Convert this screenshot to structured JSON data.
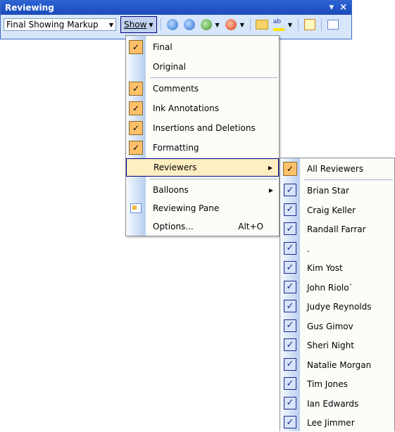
{
  "toolbar": {
    "title": "Reviewing",
    "title_controls": {
      "dropdown": "▾",
      "close": "×"
    },
    "display_for_review": "Final Showing Markup",
    "show_label": "Show",
    "highlight_glyph": "ab"
  },
  "show_menu": {
    "items": [
      {
        "label": "Final",
        "checked": true
      },
      {
        "label": "Original",
        "checked": false
      },
      {
        "label": "Comments",
        "checked": true
      },
      {
        "label": "Ink Annotations",
        "checked": true
      },
      {
        "label": "Insertions and Deletions",
        "checked": true
      },
      {
        "label": "Formatting",
        "checked": true
      },
      {
        "label": "Reviewers",
        "submenu": true,
        "highlighted": true
      },
      {
        "label": "Balloons",
        "submenu": true
      },
      {
        "label": "Reviewing Pane",
        "icon": "reviewing-pane-icon"
      },
      {
        "label": "Options...",
        "shortcut": "Alt+O"
      }
    ]
  },
  "reviewers_menu": {
    "all_reviewers": "All Reviewers",
    "reviewers": [
      "Brian Star",
      "Craig Keller",
      "Randall Farrar",
      ".",
      "Kim Yost",
      "John Riolo`",
      "Judye Reynolds",
      "Gus Gimov",
      "Sheri Night",
      "Natalie Morgan",
      "Tim Jones",
      "Ian Edwards",
      "Lee Jimmer"
    ]
  },
  "colors": {
    "title_bar": "#1b4bb8",
    "checked_bg": "#ffc069",
    "hover_bg": "#ffeec2",
    "checkbox_border": "#1b2b8c"
  }
}
